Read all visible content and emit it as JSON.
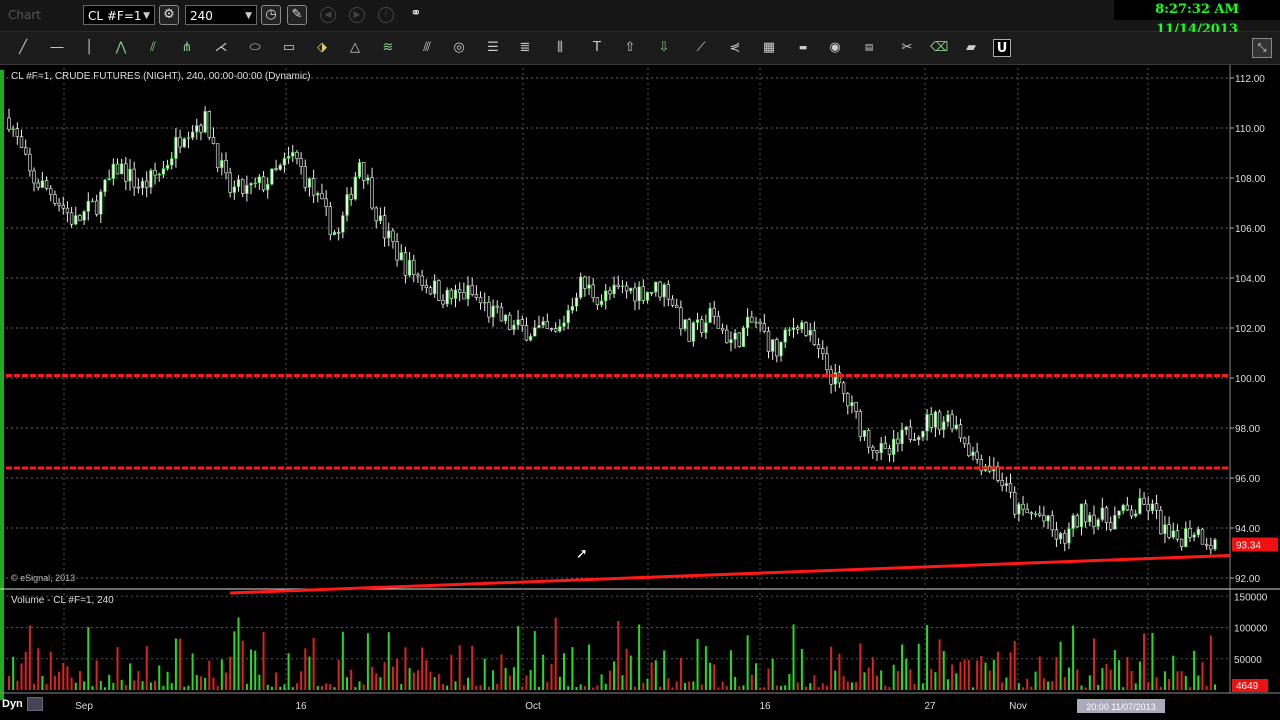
{
  "window": {
    "app_name": "Chart",
    "symbol": "CL #F=1",
    "interval": "240",
    "clock": "8:27:32 AM 11/14/2013"
  },
  "chart_data": {
    "type": "candlestick",
    "title": "CL #F=1, CRUDE FUTURES (NIGHT), 240, 00:00-00:00 (Dynamic)",
    "copyright": "© eSignal, 2013",
    "price_axis": {
      "ylim": [
        91.6,
        112.4
      ],
      "ticks": [
        "112.00",
        "110.00",
        "108.00",
        "106.00",
        "104.00",
        "102.00",
        "100.00",
        "98.00",
        "96.00",
        "94.00",
        "92.00"
      ],
      "last_price": "93.34",
      "last_price_value": 93.34
    },
    "x_axis": {
      "labels": [
        "Sep",
        "16",
        "Oct",
        "16",
        "27",
        "Nov"
      ],
      "cursor_label": "20:00 11/07/2013"
    },
    "price_path": [
      {
        "date": "Aug 29",
        "close": 110.4
      },
      {
        "date": "Aug 30",
        "close": 108.0
      },
      {
        "date": "Sep 2",
        "close": 107.4
      },
      {
        "date": "Sep 3",
        "close": 106.2
      },
      {
        "date": "Sep 4",
        "close": 107.0
      },
      {
        "date": "Sep 5",
        "close": 108.5
      },
      {
        "date": "Sep 6",
        "close": 107.6
      },
      {
        "date": "Sep 9",
        "close": 108.3
      },
      {
        "date": "Sep 10",
        "close": 110.0
      },
      {
        "date": "Sep 11",
        "close": 110.3
      },
      {
        "date": "Sep 12",
        "close": 107.5
      },
      {
        "date": "Sep 13",
        "close": 107.5
      },
      {
        "date": "Sep 16",
        "close": 108.0
      },
      {
        "date": "Sep 17",
        "close": 108.9
      },
      {
        "date": "Sep 18",
        "close": 107.2
      },
      {
        "date": "Sep 19",
        "close": 105.6
      },
      {
        "date": "Sep 20",
        "close": 108.8
      },
      {
        "date": "Sep 23",
        "close": 106.0
      },
      {
        "date": "Sep 24",
        "close": 104.6
      },
      {
        "date": "Sep 25",
        "close": 103.8
      },
      {
        "date": "Sep 26",
        "close": 103.2
      },
      {
        "date": "Sep 27",
        "close": 103.4
      },
      {
        "date": "Sep 30",
        "close": 102.6
      },
      {
        "date": "Oct 1",
        "close": 102.0
      },
      {
        "date": "Oct 2",
        "close": 101.9
      },
      {
        "date": "Oct 3",
        "close": 101.7
      },
      {
        "date": "Oct 4",
        "close": 103.8
      },
      {
        "date": "Oct 7",
        "close": 103.2
      },
      {
        "date": "Oct 8",
        "close": 103.5
      },
      {
        "date": "Oct 9",
        "close": 103.5
      },
      {
        "date": "Oct 10",
        "close": 103.6
      },
      {
        "date": "Oct 11",
        "close": 101.6
      },
      {
        "date": "Oct 14",
        "close": 102.5
      },
      {
        "date": "Oct 15",
        "close": 101.4
      },
      {
        "date": "Oct 16",
        "close": 102.3
      },
      {
        "date": "Oct 17",
        "close": 101.0
      },
      {
        "date": "Oct 18",
        "close": 102.4
      },
      {
        "date": "Oct 21",
        "close": 100.8
      },
      {
        "date": "Oct 22",
        "close": 99.4
      },
      {
        "date": "Oct 23",
        "close": 97.8
      },
      {
        "date": "Oct 24",
        "close": 96.8
      },
      {
        "date": "Oct 25",
        "close": 97.8
      },
      {
        "date": "Oct 28",
        "close": 98.3
      },
      {
        "date": "Oct 29",
        "close": 98.4
      },
      {
        "date": "Oct 30",
        "close": 96.9
      },
      {
        "date": "Oct 31",
        "close": 96.3
      },
      {
        "date": "Nov 1",
        "close": 94.6
      },
      {
        "date": "Nov 4",
        "close": 94.5
      },
      {
        "date": "Nov 5",
        "close": 93.4
      },
      {
        "date": "Nov 6",
        "close": 94.7
      },
      {
        "date": "Nov 7",
        "close": 94.3
      },
      {
        "date": "Nov 8",
        "close": 94.6
      },
      {
        "date": "Nov 11",
        "close": 94.9
      },
      {
        "date": "Nov 12",
        "close": 93.4
      },
      {
        "date": "Nov 13",
        "close": 94.0
      },
      {
        "date": "Nov 14",
        "close": 93.34
      }
    ],
    "horizontal_lines": [
      100.1,
      96.4
    ],
    "trend_line": {
      "start": 91.4,
      "end": 92.9
    },
    "volume_panel": {
      "title": "Volume - CL #F=1, 240",
      "ticks": [
        "150000",
        "100000",
        "50000"
      ],
      "ylim": [
        0,
        160000
      ],
      "last_value": "4649"
    }
  }
}
